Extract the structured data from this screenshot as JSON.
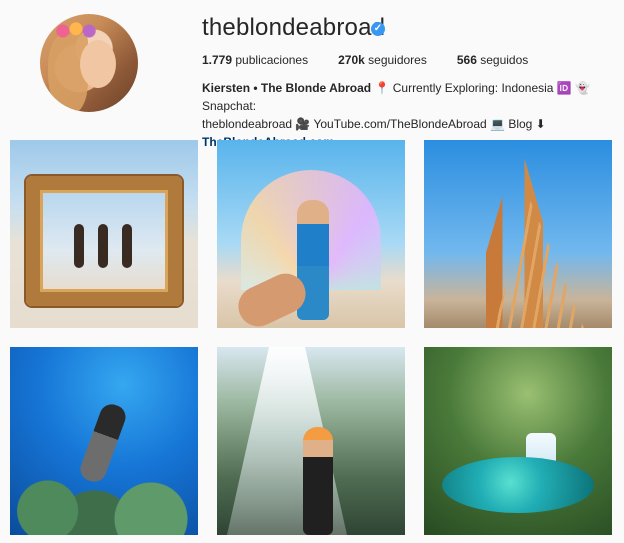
{
  "profile": {
    "username": "theblondeabroad",
    "verified_badge": "verified-checkmark-icon",
    "stats": {
      "posts": {
        "count": "1.779",
        "label": "publicaciones"
      },
      "followers": {
        "count": "270k",
        "label": "seguidores"
      },
      "following": {
        "count": "566",
        "label": "seguidos"
      }
    },
    "bio": {
      "name": "Kiersten • The Blonde Abroad",
      "line1_rest": "📍 Currently Exploring: Indonesia 🆔 👻 Snapchat:",
      "line2": "theblondeabroad 🎥 YouTube.com/TheBlondeAbroad 💻 Blog ⬇",
      "link": "TheBlondeAbroad.com"
    }
  },
  "grid": {
    "posts": [
      {
        "name": "post-desert-frame"
      },
      {
        "name": "post-burning-man-arch"
      },
      {
        "name": "post-golden-tower"
      },
      {
        "name": "post-scuba-dive"
      },
      {
        "name": "post-waterfall"
      },
      {
        "name": "post-jungle-lagoon"
      }
    ]
  },
  "colors": {
    "background": "#fafafa",
    "text": "#262626",
    "link": "#003569",
    "verified_blue": "#3897f0"
  }
}
